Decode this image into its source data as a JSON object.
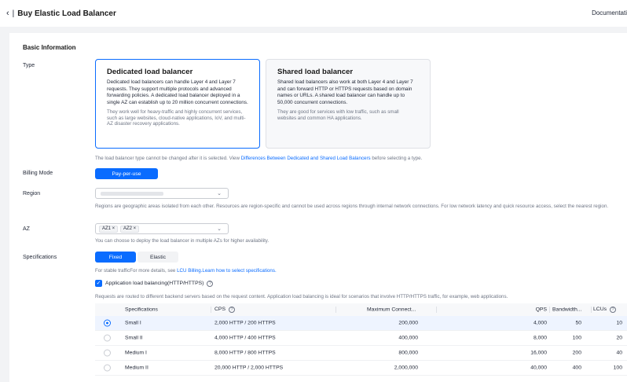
{
  "header": {
    "back_icon": "‹",
    "separator": "|",
    "title": "Buy Elastic Load Balancer",
    "doc_link": "Documentati"
  },
  "basic": {
    "section_title": "Basic Information",
    "type_label": "Type",
    "dedicated": {
      "title": "Dedicated load balancer",
      "desc": "Dedicated load balancers can handle Layer 4 and Layer 7 requests. They support multiple protocols and advanced forwarding policies. A dedicated load balancer deployed in a single AZ can establish up to 20 million concurrent connections.",
      "note": "They work well for heavy-traffic and highly concurrent services, such as large websites, cloud-native applications, IoV, and multi-AZ disaster recovery applications."
    },
    "shared": {
      "title": "Shared load balancer",
      "desc": "Shared load balancers also work at both Layer 4 and Layer 7 and can forward HTTP or HTTPS requests based on domain names or URLs. A shared load balancer can handle up to 50,000 concurrent connections.",
      "note": "They are good for services with low traffic, such as small websites and common HA applications."
    },
    "type_hint_pre": "The load balancer type cannot be changed after it is selected. View ",
    "type_hint_link": "Differences Between Dedicated and Shared Load Balancers",
    "type_hint_post": " before selecting a type.",
    "billing_label": "Billing Mode",
    "billing_value": "Pay-per-use",
    "region_label": "Region",
    "region_hint": "Regions are geographic areas isolated from each other. Resources are region-specific and cannot be used across regions through internal network connections. For low network latency and quick resource access, select the nearest region.",
    "az_label": "AZ",
    "az_tags": [
      "AZ1 ×",
      "AZ2 ×"
    ],
    "az_hint": "You can choose to deploy the load balancer in multiple AZs for higher availability.",
    "spec_label": "Specifications",
    "spec_fixed": "Fixed",
    "spec_elastic": "Elastic",
    "spec_hint_pre": "For stable trafficFor more details, see ",
    "spec_hint_link1": "LCU Billing.",
    "spec_hint_link2": "Learn how to select specifications.",
    "alb_label": "Application load balancing(HTTP/HTTPS)",
    "alb_hint": "Requests are routed to different backend servers based on the request content. Application load balancing is ideal for scenarios that involve HTTP/HTTPS traffic, for example, web applications.",
    "chevron": "⌄",
    "check": "✓",
    "help": "?"
  },
  "table": {
    "headers": [
      "Specifications",
      "CPS",
      "Maximum Connect...",
      "QPS",
      "Bandwidth...",
      "LCUs"
    ],
    "rows": [
      [
        "Small I",
        "2,000 HTTP / 200 HTTPS",
        "200,000",
        "4,000",
        "50",
        "10"
      ],
      [
        "Small II",
        "4,000 HTTP / 400 HTTPS",
        "400,000",
        "8,000",
        "100",
        "20"
      ],
      [
        "Medium I",
        "8,000 HTTP / 800 HTTPS",
        "800,000",
        "16,000",
        "200",
        "40"
      ],
      [
        "Medium II",
        "20,000 HTTP / 2,000 HTTPS",
        "2,000,000",
        "40,000",
        "400",
        "100"
      ]
    ]
  }
}
